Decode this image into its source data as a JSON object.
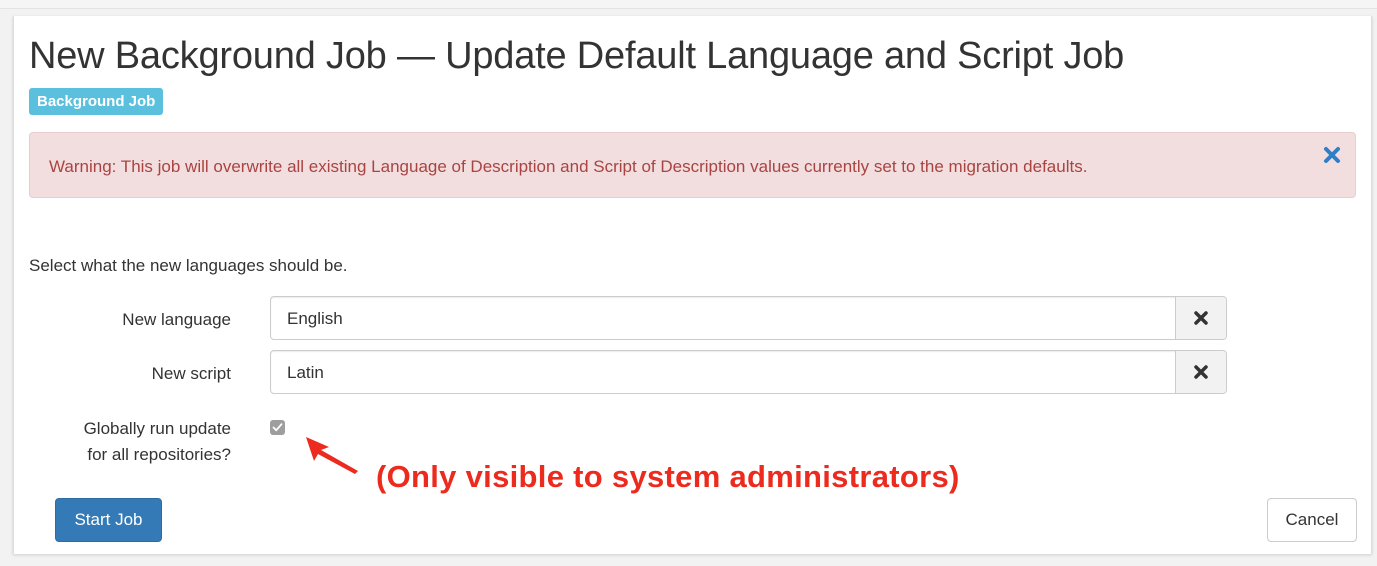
{
  "page": {
    "title": "New Background Job — Update Default Language and Script Job",
    "badge": "Background Job"
  },
  "alert": {
    "message": "Warning: This job will overwrite all existing Language of Description and Script of Description values currently set to the migration defaults.",
    "close_icon": "close-icon"
  },
  "form": {
    "intro": "Select what the new languages should be.",
    "language": {
      "label": "New language",
      "value": "English",
      "clear_icon": "clear-icon"
    },
    "script": {
      "label": "New script",
      "value": "Latin",
      "clear_icon": "clear-icon"
    },
    "global": {
      "label_line1": "Globally run update",
      "label_line2": "for all repositories?",
      "checked": true
    }
  },
  "annotation": {
    "text": "(Only visible to system administrators)",
    "color": "#ec2a1e"
  },
  "actions": {
    "start_label": "Start Job",
    "cancel_label": "Cancel"
  },
  "colors": {
    "primary": "#337ab7",
    "badge": "#5bc0de",
    "alert_bg": "#f2dede",
    "alert_text": "#a94442"
  }
}
